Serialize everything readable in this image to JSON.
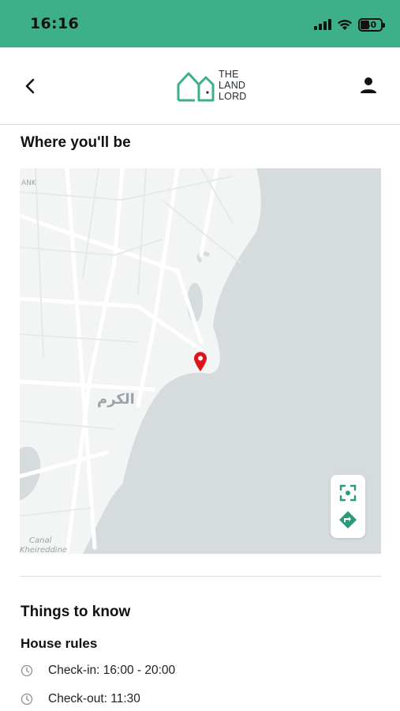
{
  "status_bar": {
    "time": "16:16",
    "battery_level": "40",
    "background_color": "#3db08a"
  },
  "header": {
    "logo_lines": [
      "THE",
      "LAND",
      "LORD"
    ],
    "brand_color": "#3db08a",
    "back_icon": "chevron-left-icon",
    "profile_icon": "person-icon"
  },
  "location": {
    "title": "Where you'll be",
    "map_labels": {
      "city": "الكرم",
      "corner": "ANK",
      "canal": "Canal",
      "kheireddine": "Kheireddine"
    },
    "pin_color": "#e0121b",
    "controls": {
      "recenter_icon": "focus-icon",
      "directions_icon": "directions-icon"
    }
  },
  "things_to_know": {
    "title": "Things to know",
    "house_rules": {
      "title": "House rules",
      "items": [
        {
          "icon": "clock-icon",
          "text": "Check-in: 16:00 - 20:00"
        },
        {
          "icon": "clock-icon",
          "text": "Check-out: 11:30"
        }
      ]
    }
  }
}
